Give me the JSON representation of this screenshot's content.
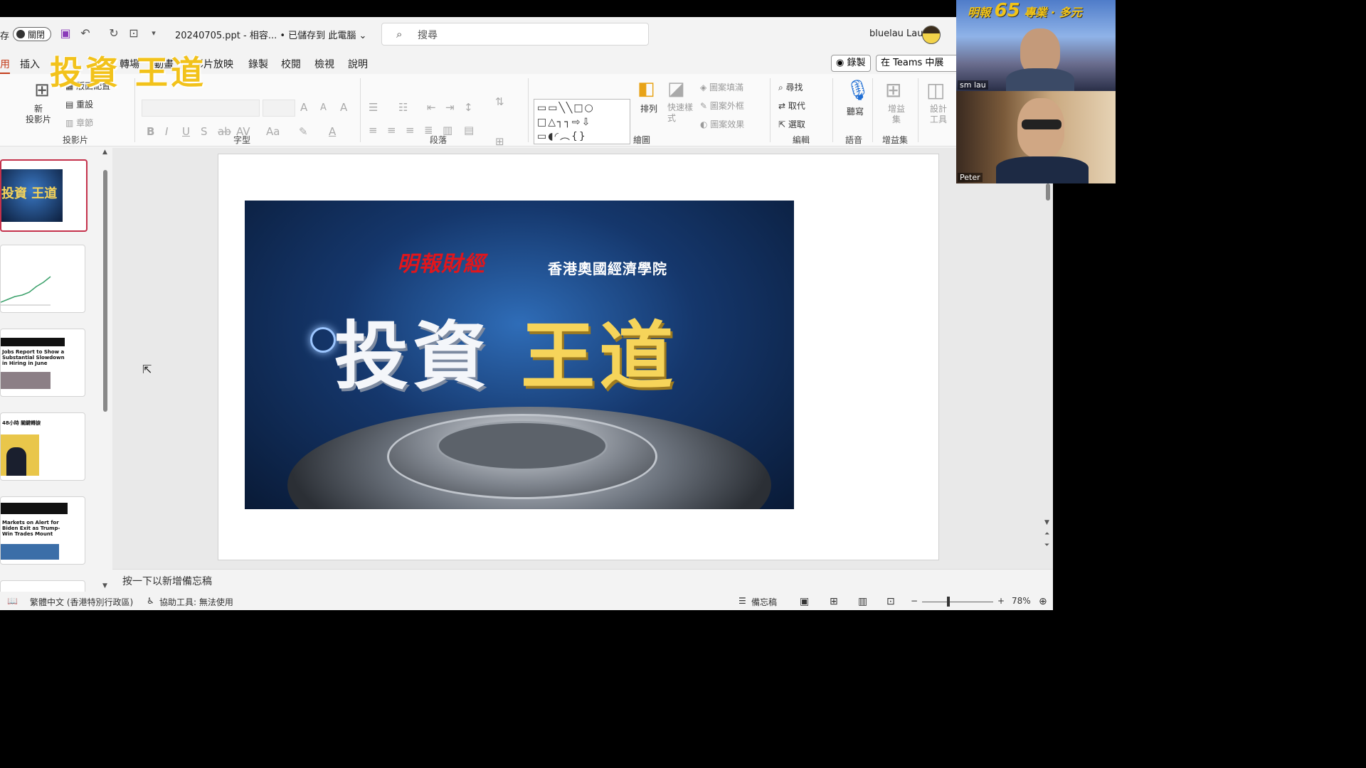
{
  "titlebar": {
    "autosave_label": "存",
    "autosave_state": "關閉",
    "doc_title": "20240705.ppt  -  相容...  •  已儲存到 此電腦 ⌄",
    "search_placeholder": "搜尋",
    "username": "bluelau Lau"
  },
  "tabs": [
    "用",
    "插入",
    "轉場",
    "動畫",
    "投影片放映",
    "錄製",
    "校閱",
    "檢視",
    "說明"
  ],
  "actions": {
    "record": "錄製",
    "teams": "在 Teams 中展"
  },
  "overlay_title": "投資 王道",
  "ribbon": {
    "slides": {
      "new_slide": "新\n投影片",
      "layout": "版面配置",
      "reset": "重設",
      "section": "章節",
      "group": "投影片"
    },
    "font": {
      "group": "字型"
    },
    "paragraph": {
      "group": "段落"
    },
    "drawing": {
      "arrange": "排列",
      "quick_styles": "快速樣式",
      "fill": "圖案填滿",
      "outline": "圖案外框",
      "effects": "圖案效果",
      "group": "繪圖"
    },
    "editing": {
      "find": "尋找",
      "replace": "取代",
      "select": "選取",
      "group": "編輯"
    },
    "voice": {
      "dictate": "聽寫",
      "group": "語音"
    },
    "addins": {
      "label": "增益集",
      "group": "增益集"
    },
    "designer": {
      "label": "設計工具"
    }
  },
  "thumbnails": [
    {
      "title": "投資 王道",
      "selected": true
    },
    {
      "title": "",
      "selected": false
    },
    {
      "title": "Jobs Report to Show a Substantial Slowdown in Hiring in June",
      "selected": false
    },
    {
      "title": "48小時 關鍵轉捩",
      "selected": false
    },
    {
      "title": "Markets on Alert for Biden Exit as Trump-Win Trades Mount",
      "selected": false
    }
  ],
  "slide": {
    "publisher": "明報財經",
    "academy": "香港奧國經濟學院",
    "title_white": "投資",
    "title_gold": "王道"
  },
  "notes_placeholder": "按一下以新增備忘稿",
  "status": {
    "language": "繁體中文 (香港特別行政區)",
    "accessibility": "協助工具: 無法使用",
    "notes": "備忘稿",
    "zoom": "78%"
  },
  "video": {
    "participant1": "sm lau",
    "participant2": "Peter",
    "banner_logo": "明報",
    "banner_number": "65",
    "banner_text": "專業 · 多元"
  },
  "colors": {
    "accent": "#c43e1c",
    "selected_thumb": "#c4314b",
    "overlay_gold": "#f2c21b"
  }
}
